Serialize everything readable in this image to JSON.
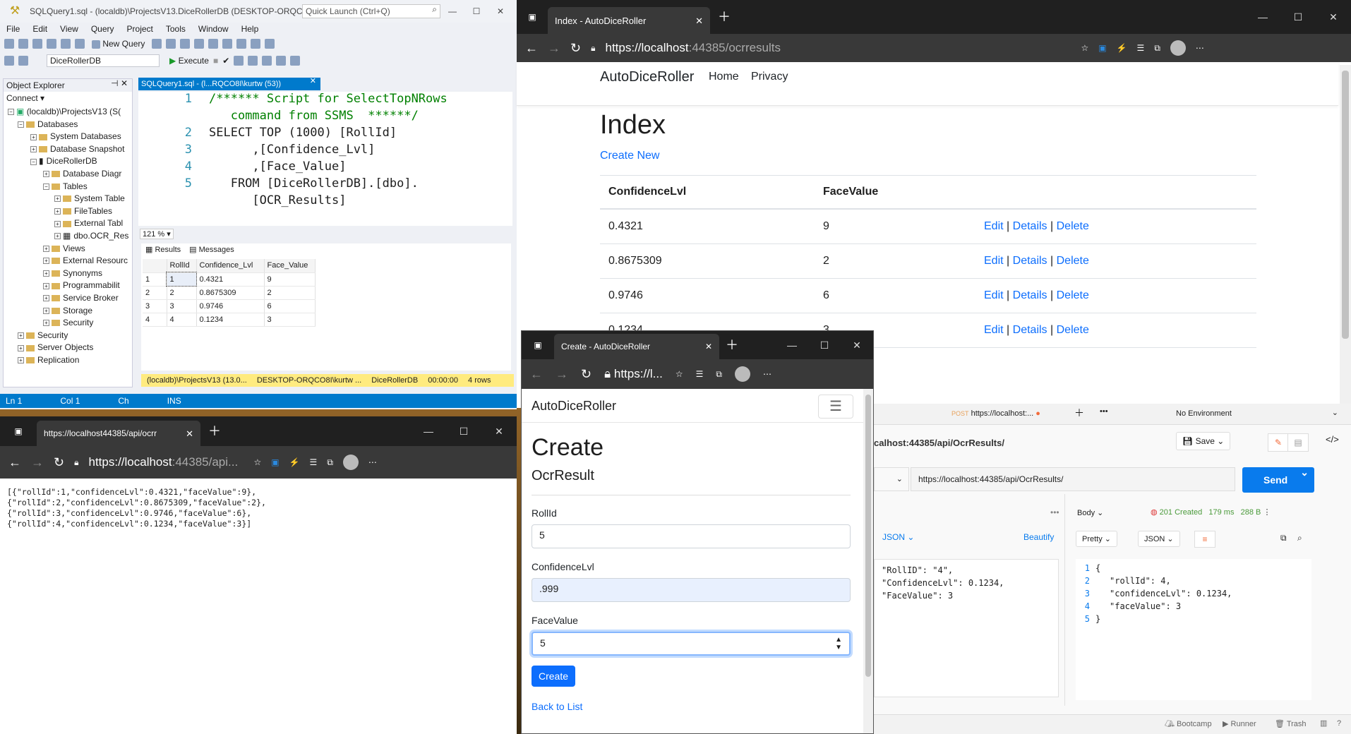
{
  "ssms": {
    "title": "SQLQuery1.sql - (localdb)\\ProjectsV13.DiceRollerDB (DESKTOP-ORQC...",
    "quick_launch": "Quick Launch (Ctrl+Q)",
    "menu": [
      "File",
      "Edit",
      "View",
      "Query",
      "Project",
      "Tools",
      "Window",
      "Help"
    ],
    "new_query": "New Query",
    "db_select": "DiceRollerDB",
    "execute": "Execute",
    "oe_title": "Object Explorer",
    "connect": "Connect",
    "tree": [
      "(localdb)\\ProjectsV13 (S(",
      "Databases",
      "System Databases",
      "Database Snapshot",
      "DiceRollerDB",
      "Database Diagr",
      "Tables",
      "System Table",
      "FileTables",
      "External Tabl",
      "dbo.OCR_Res",
      "Views",
      "External Resourc",
      "Synonyms",
      "Programmabilit",
      "Service Broker",
      "Storage",
      "Security",
      "Security",
      "Server Objects",
      "Replication"
    ],
    "tab": "SQLQuery1.sql - (l...RQCO8I\\kurtw (53))",
    "code": [
      {
        "n": "1",
        "t": "/****** Script for SelectTopNRows"
      },
      {
        "n": "",
        "t": "   command from SSMS  ******/"
      },
      {
        "n": "2",
        "t": "SELECT TOP (1000) [RollId]"
      },
      {
        "n": "3",
        "t": "      ,[Confidence_Lvl]"
      },
      {
        "n": "4",
        "t": "      ,[Face_Value]"
      },
      {
        "n": "5",
        "t": "   FROM [DiceRollerDB].[dbo]."
      },
      {
        "n": "",
        "t": "      [OCR_Results]"
      }
    ],
    "zoom": "121 %",
    "results_tab": "Results",
    "messages_tab": "Messages",
    "grid_headers": [
      "",
      "RollId",
      "Confidence_Lvl",
      "Face_Value"
    ],
    "grid_rows": [
      [
        "1",
        "1",
        "0.4321",
        "9"
      ],
      [
        "2",
        "2",
        "0.8675309",
        "2"
      ],
      [
        "3",
        "3",
        "0.9746",
        "6"
      ],
      [
        "4",
        "4",
        "0.1234",
        "3"
      ]
    ],
    "status": [
      "(localdb)\\ProjectsV13 (13.0...",
      "DESKTOP-ORQCO8I\\kurtw ...",
      "DiceRollerDB",
      "00:00:00",
      "4 rows"
    ],
    "vs_status": [
      "Ln 1",
      "Col 1",
      "Ch",
      "INS"
    ]
  },
  "edge1": {
    "tab": "Index - AutoDiceRoller",
    "url_host": "https://localhost",
    "url_rest": ":44385/ocrresults",
    "brand": "AutoDiceRoller",
    "nav": [
      "Home",
      "Privacy"
    ],
    "heading": "Index",
    "create_new": "Create New",
    "col_conf": "ConfidenceLvl",
    "col_face": "FaceValue",
    "rows": [
      {
        "conf": "0.4321",
        "face": "9"
      },
      {
        "conf": "0.8675309",
        "face": "2"
      },
      {
        "conf": "0.9746",
        "face": "6"
      },
      {
        "conf": "0.1234",
        "face": "3"
      }
    ],
    "actions": [
      "Edit",
      "Details",
      "Delete"
    ],
    "sep": "|"
  },
  "edge2": {
    "tab": "https://localhost44385/api/ocrr",
    "url_host": "https://localhost",
    "url_rest": ":44385/api...",
    "json_lines": [
      "[{\"rollId\":1,\"confidenceLvl\":0.4321,\"faceValue\":9},",
      "{\"rollId\":2,\"confidenceLvl\":0.8675309,\"faceValue\":2},",
      "{\"rollId\":3,\"confidenceLvl\":0.9746,\"faceValue\":6},",
      "{\"rollId\":4,\"confidenceLvl\":0.1234,\"faceValue\":3}]"
    ]
  },
  "edge3": {
    "tab": "Create - AutoDiceRoller",
    "url": "https://l...",
    "brand": "AutoDiceRoller",
    "heading": "Create",
    "subheading": "OcrResult",
    "f1_label": "RollId",
    "f1_value": "5",
    "f2_label": "ConfidenceLvl",
    "f2_value": ".999",
    "f3_label": "FaceValue",
    "f3_value": "5",
    "create_btn": "Create",
    "back": "Back to List"
  },
  "postman": {
    "method": "POST",
    "tab_url": "https://localhost:...",
    "env": "No Environment",
    "title": "calhost:44385/api/OcrResults/",
    "save": "Save",
    "req_url": "https://localhost:44385/api/OcrResults/",
    "send": "Send",
    "body_fmt": "JSON",
    "beautify": "Beautify",
    "req_lines": [
      "\"RollID\": \"4\",",
      "\"ConfidenceLvl\": 0.1234,",
      "\"FaceValue\": 3"
    ],
    "resp_tab": "Body",
    "status": "201 Created",
    "time": "179 ms",
    "size": "288 B",
    "pretty": "Pretty",
    "resp_fmt": "JSON",
    "resp_nums": [
      "1",
      "2",
      "3",
      "4",
      "5"
    ],
    "resp_lines": [
      "{",
      "\"rollId\": 4,",
      "\"confidenceLvl\": 0.1234,",
      "\"faceValue\": 3",
      "}"
    ],
    "footer": [
      "Bootcamp",
      "Runner",
      "Trash"
    ]
  },
  "colors": {
    "accent": "#007acc",
    "link": "#0d6efd",
    "status_yellow": "#ffeb7f",
    "postman_blue": "#097bed"
  }
}
